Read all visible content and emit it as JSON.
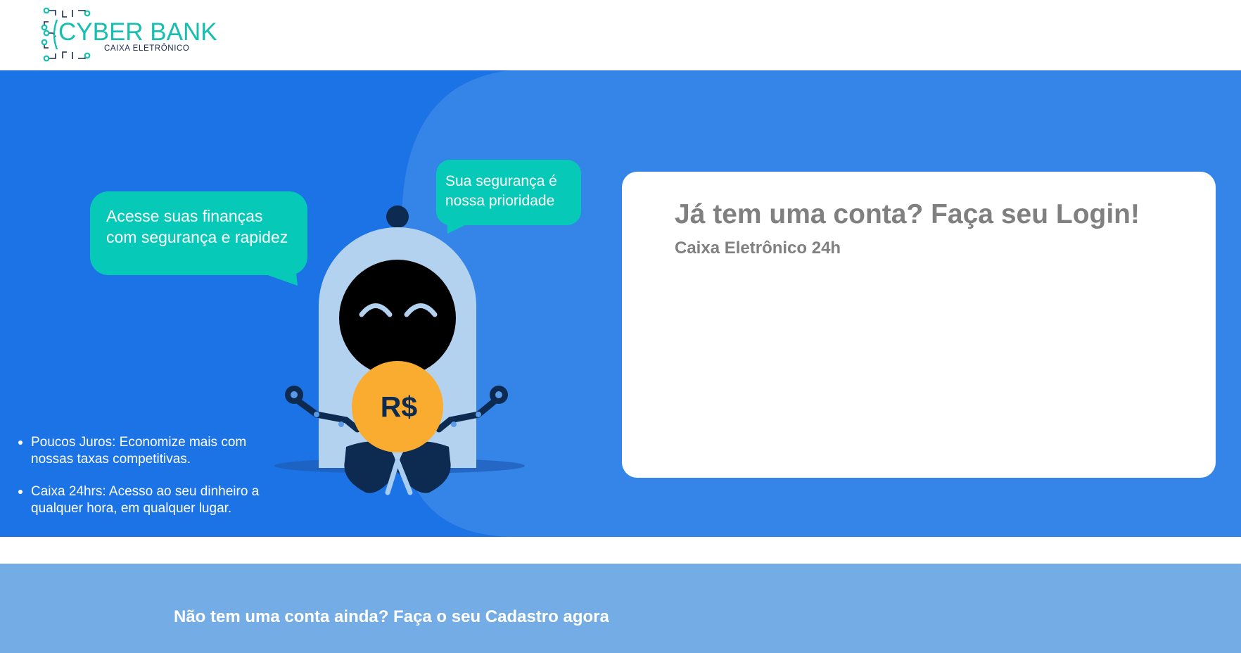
{
  "header": {
    "logo_title": "CYBER BANK",
    "logo_subtitle": "CAIXA ELETRÔNICO"
  },
  "hero": {
    "bubble_left": "Acesse suas finanças com segurança e rapidez",
    "bubble_right": "Sua segurança é nossa prioridade",
    "coin_label": "R$",
    "features": [
      "Poucos Juros: Economize mais com nossas taxas competitivas.",
      "Caixa 24hrs: Acesso ao seu dinheiro a qualquer hora, em qualquer lugar."
    ]
  },
  "login": {
    "title": "Já tem uma conta? Faça seu Login!",
    "subtitle": "Caixa Eletrônico 24h"
  },
  "footer": {
    "signup_text": "Não tem uma conta ainda? Faça o seu Cadastro agora"
  },
  "colors": {
    "brand_teal": "#16bfb0",
    "hero_blue": "#1b73e6",
    "hero_blue_light": "#3585e9",
    "bubble_teal": "#07c9b8",
    "coin_gold": "#f9ac2f",
    "footer_blue": "#74ade6",
    "text_gray": "#808080"
  },
  "icons": [
    "circuit-logo-icon",
    "robot-mascot-illustration"
  ]
}
